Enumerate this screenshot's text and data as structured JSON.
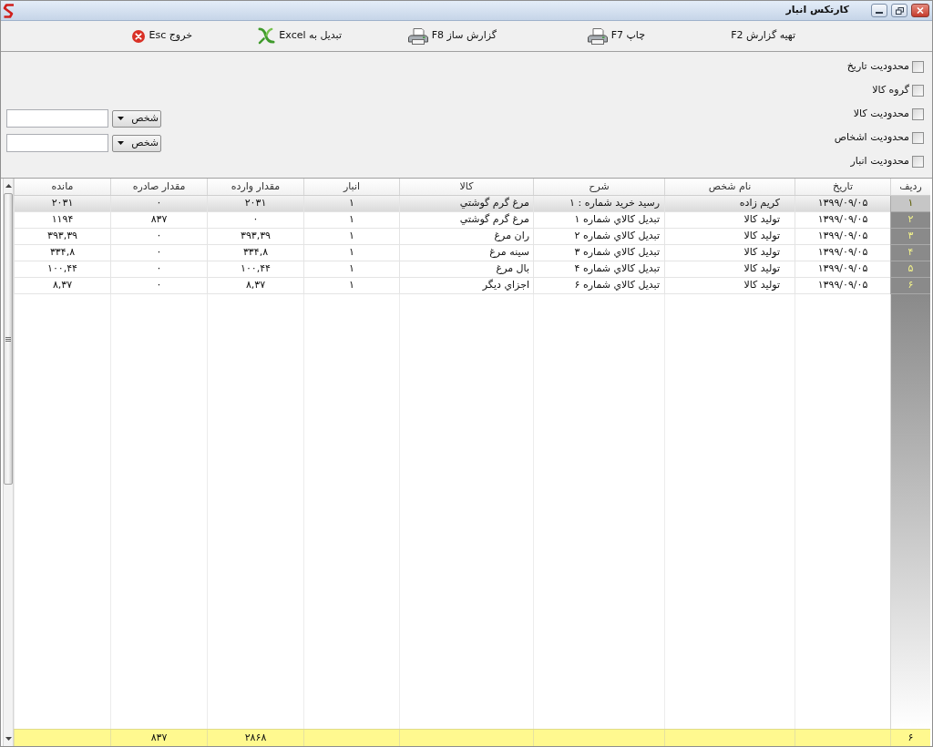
{
  "window": {
    "title": "کارتکس انبار"
  },
  "toolbar": [
    {
      "label": "تهیه گزارش F2",
      "kind": "text"
    },
    {
      "label": "چاپ F7",
      "kind": "printer"
    },
    {
      "label": "گزارش ساز F8",
      "kind": "printer"
    },
    {
      "label": "تبدیل به Excel",
      "kind": "excel"
    },
    {
      "label": "خروج Esc",
      "kind": "exit"
    }
  ],
  "filters": {
    "checkboxes": [
      {
        "label": "محدودیت تاریخ",
        "checked": false
      },
      {
        "label": "گروه کالا",
        "checked": false
      },
      {
        "label": "محدودیت کالا",
        "checked": false
      },
      {
        "label": "محدودیت اشخاص",
        "checked": false
      },
      {
        "label": "محدودیت انبار",
        "checked": false
      }
    ],
    "pickers": [
      {
        "value": "شخص"
      },
      {
        "value": "شخص"
      }
    ]
  },
  "table": {
    "columns": [
      "ردیف",
      "تاریخ",
      "نام شخص",
      "شرح",
      "کالا",
      "انبار",
      "مقدار وارده",
      "مقدار صادره",
      "مانده"
    ],
    "rows": [
      {
        "selected": true,
        "cells": [
          "۱",
          "۱۳۹۹/۰۹/۰۵",
          "کریم زاده",
          "رسید خرید شماره : ۱",
          "مرغ گرم گوشتي",
          "۱",
          "۲۰۳۱",
          "۰",
          "۲۰۳۱"
        ]
      },
      {
        "selected": false,
        "cells": [
          "۲",
          "۱۳۹۹/۰۹/۰۵",
          "تولید کالا",
          "تبدیل کالاي شماره ۱",
          "مرغ گرم گوشتي",
          "۱",
          "۰",
          "۸۳۷",
          "۱۱۹۴"
        ]
      },
      {
        "selected": false,
        "cells": [
          "۳",
          "۱۳۹۹/۰۹/۰۵",
          "تولید کالا",
          "تبدیل کالاي شماره ۲",
          "ران مرغ",
          "۱",
          "۳۹۳,۳۹",
          "۰",
          "۳۹۳,۳۹"
        ]
      },
      {
        "selected": false,
        "cells": [
          "۴",
          "۱۳۹۹/۰۹/۰۵",
          "تولید کالا",
          "تبدیل کالاي شماره ۳",
          "سینه مرغ",
          "۱",
          "۳۳۴,۸",
          "۰",
          "۳۳۴,۸"
        ]
      },
      {
        "selected": false,
        "cells": [
          "۵",
          "۱۳۹۹/۰۹/۰۵",
          "تولید کالا",
          "تبدیل کالاي شماره ۴",
          "بال مرغ",
          "۱",
          "۱۰۰,۴۴",
          "۰",
          "۱۰۰,۴۴"
        ]
      },
      {
        "selected": false,
        "cells": [
          "۶",
          "۱۳۹۹/۰۹/۰۵",
          "تولید کالا",
          "تبدیل کالاي شماره ۶",
          "اجزاي دیگر",
          "۱",
          "۸,۳۷",
          "۰",
          "۸,۳۷"
        ]
      }
    ],
    "footer": {
      "row_count": "۶",
      "incoming_total": "۲۸۶۸",
      "outgoing_total": "۸۳۷"
    }
  }
}
